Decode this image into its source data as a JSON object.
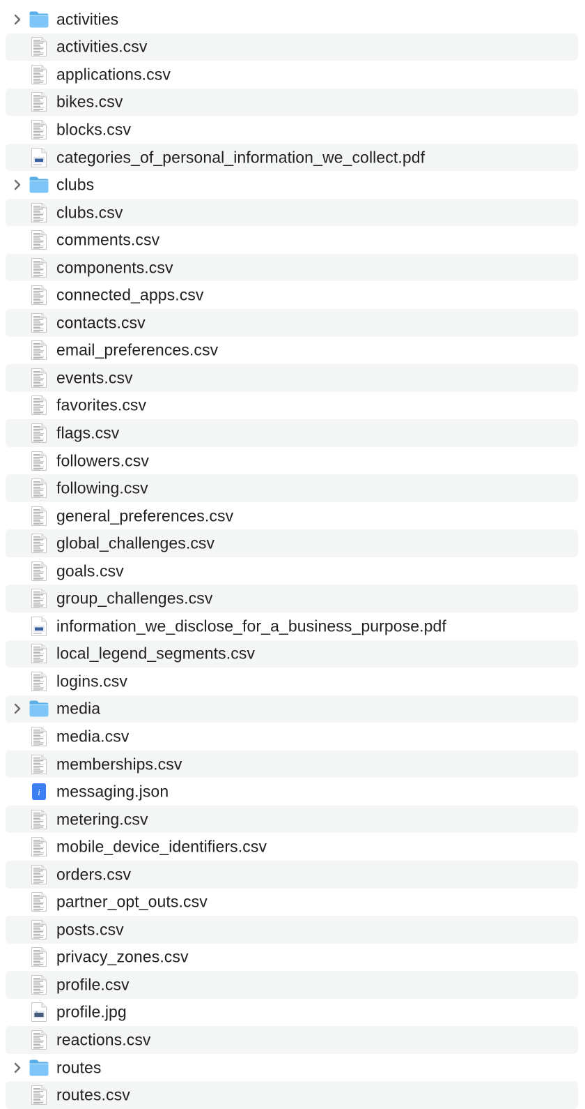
{
  "colors": {
    "row_alt": "#f4f5f5",
    "text": "#202020",
    "folder": "#6fbef5",
    "json_badge": "#3b7ff2"
  },
  "items": [
    {
      "name": "activities",
      "kind": "folder",
      "icon": "folder-icon"
    },
    {
      "name": "activities.csv",
      "kind": "csv",
      "icon": "csv-document-icon"
    },
    {
      "name": "applications.csv",
      "kind": "csv",
      "icon": "csv-document-icon"
    },
    {
      "name": "bikes.csv",
      "kind": "csv",
      "icon": "csv-document-icon"
    },
    {
      "name": "blocks.csv",
      "kind": "csv",
      "icon": "csv-document-icon"
    },
    {
      "name": "categories_of_personal_information_we_collect.pdf",
      "kind": "pdf",
      "icon": "pdf-document-icon"
    },
    {
      "name": "clubs",
      "kind": "folder",
      "icon": "folder-icon"
    },
    {
      "name": "clubs.csv",
      "kind": "csv",
      "icon": "csv-document-icon"
    },
    {
      "name": "comments.csv",
      "kind": "csv",
      "icon": "csv-document-icon"
    },
    {
      "name": "components.csv",
      "kind": "csv",
      "icon": "csv-document-icon"
    },
    {
      "name": "connected_apps.csv",
      "kind": "csv",
      "icon": "csv-document-icon"
    },
    {
      "name": "contacts.csv",
      "kind": "csv",
      "icon": "csv-document-icon"
    },
    {
      "name": "email_preferences.csv",
      "kind": "csv",
      "icon": "csv-document-icon"
    },
    {
      "name": "events.csv",
      "kind": "csv",
      "icon": "csv-document-icon"
    },
    {
      "name": "favorites.csv",
      "kind": "csv",
      "icon": "csv-document-icon"
    },
    {
      "name": "flags.csv",
      "kind": "csv",
      "icon": "csv-document-icon"
    },
    {
      "name": "followers.csv",
      "kind": "csv",
      "icon": "csv-document-icon"
    },
    {
      "name": "following.csv",
      "kind": "csv",
      "icon": "csv-document-icon"
    },
    {
      "name": "general_preferences.csv",
      "kind": "csv",
      "icon": "csv-document-icon"
    },
    {
      "name": "global_challenges.csv",
      "kind": "csv",
      "icon": "csv-document-icon"
    },
    {
      "name": "goals.csv",
      "kind": "csv",
      "icon": "csv-document-icon"
    },
    {
      "name": "group_challenges.csv",
      "kind": "csv",
      "icon": "csv-document-icon"
    },
    {
      "name": "information_we_disclose_for_a_business_purpose.pdf",
      "kind": "pdf",
      "icon": "pdf-document-icon"
    },
    {
      "name": "local_legend_segments.csv",
      "kind": "csv",
      "icon": "csv-document-icon"
    },
    {
      "name": "logins.csv",
      "kind": "csv",
      "icon": "csv-document-icon"
    },
    {
      "name": "media",
      "kind": "folder",
      "icon": "folder-icon"
    },
    {
      "name": "media.csv",
      "kind": "csv",
      "icon": "csv-document-icon"
    },
    {
      "name": "memberships.csv",
      "kind": "csv",
      "icon": "csv-document-icon"
    },
    {
      "name": "messaging.json",
      "kind": "json",
      "icon": "json-document-icon"
    },
    {
      "name": "metering.csv",
      "kind": "csv",
      "icon": "csv-document-icon"
    },
    {
      "name": "mobile_device_identifiers.csv",
      "kind": "csv",
      "icon": "csv-document-icon"
    },
    {
      "name": "orders.csv",
      "kind": "csv",
      "icon": "csv-document-icon"
    },
    {
      "name": "partner_opt_outs.csv",
      "kind": "csv",
      "icon": "csv-document-icon"
    },
    {
      "name": "posts.csv",
      "kind": "csv",
      "icon": "csv-document-icon"
    },
    {
      "name": "privacy_zones.csv",
      "kind": "csv",
      "icon": "csv-document-icon"
    },
    {
      "name": "profile.csv",
      "kind": "csv",
      "icon": "csv-document-icon"
    },
    {
      "name": "profile.jpg",
      "kind": "image",
      "icon": "image-document-icon"
    },
    {
      "name": "reactions.csv",
      "kind": "csv",
      "icon": "csv-document-icon"
    },
    {
      "name": "routes",
      "kind": "folder",
      "icon": "folder-icon"
    },
    {
      "name": "routes.csv",
      "kind": "csv",
      "icon": "csv-document-icon"
    }
  ]
}
